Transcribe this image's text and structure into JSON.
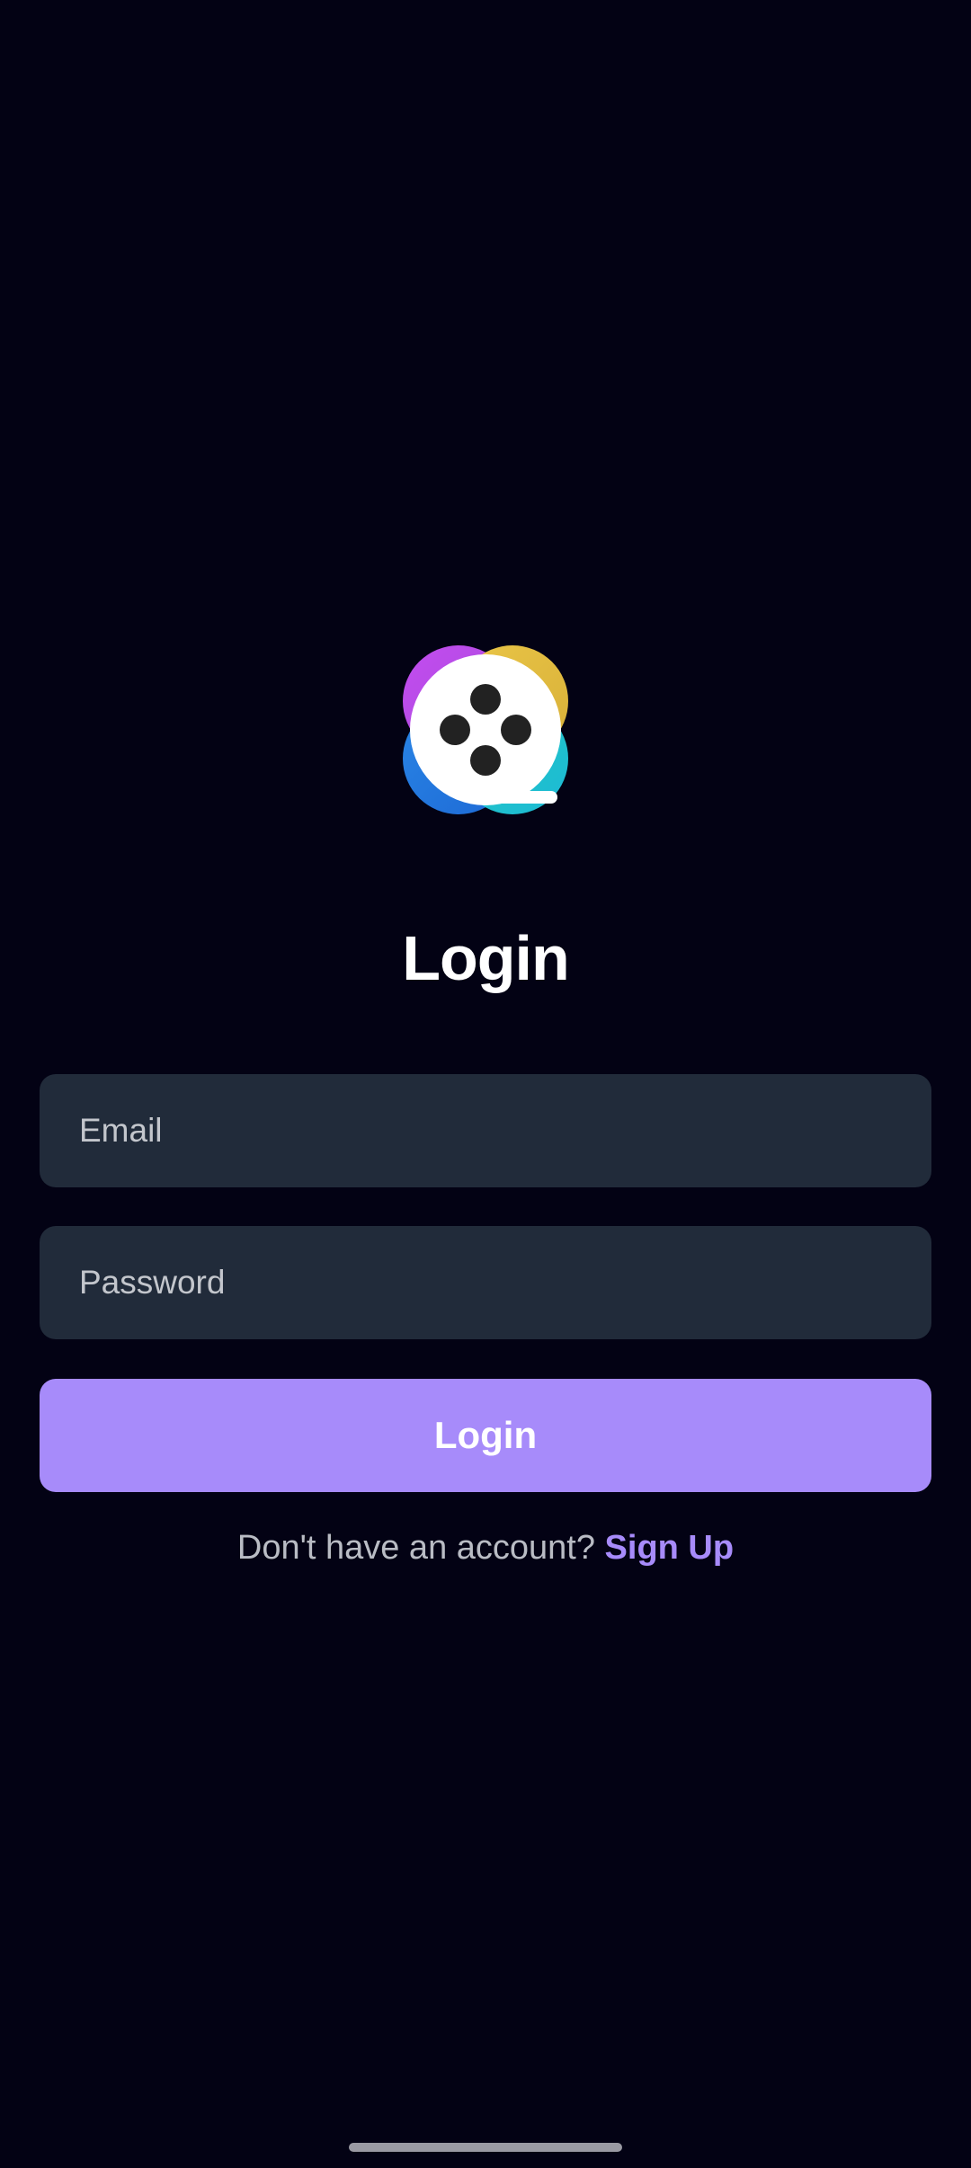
{
  "app": {
    "logo_icon": "film-reel-logo-icon"
  },
  "login": {
    "title": "Login",
    "email_placeholder": "Email",
    "email_value": "",
    "password_placeholder": "Password",
    "password_value": "",
    "submit_label": "Login",
    "signup_prompt": "Don't have an account?",
    "signup_link": "Sign Up"
  },
  "colors": {
    "background": "#030214",
    "field_background": "#212b3a",
    "accent": "#a78bfa",
    "text_primary": "#ffffff",
    "text_secondary": "#b9bcc4"
  }
}
